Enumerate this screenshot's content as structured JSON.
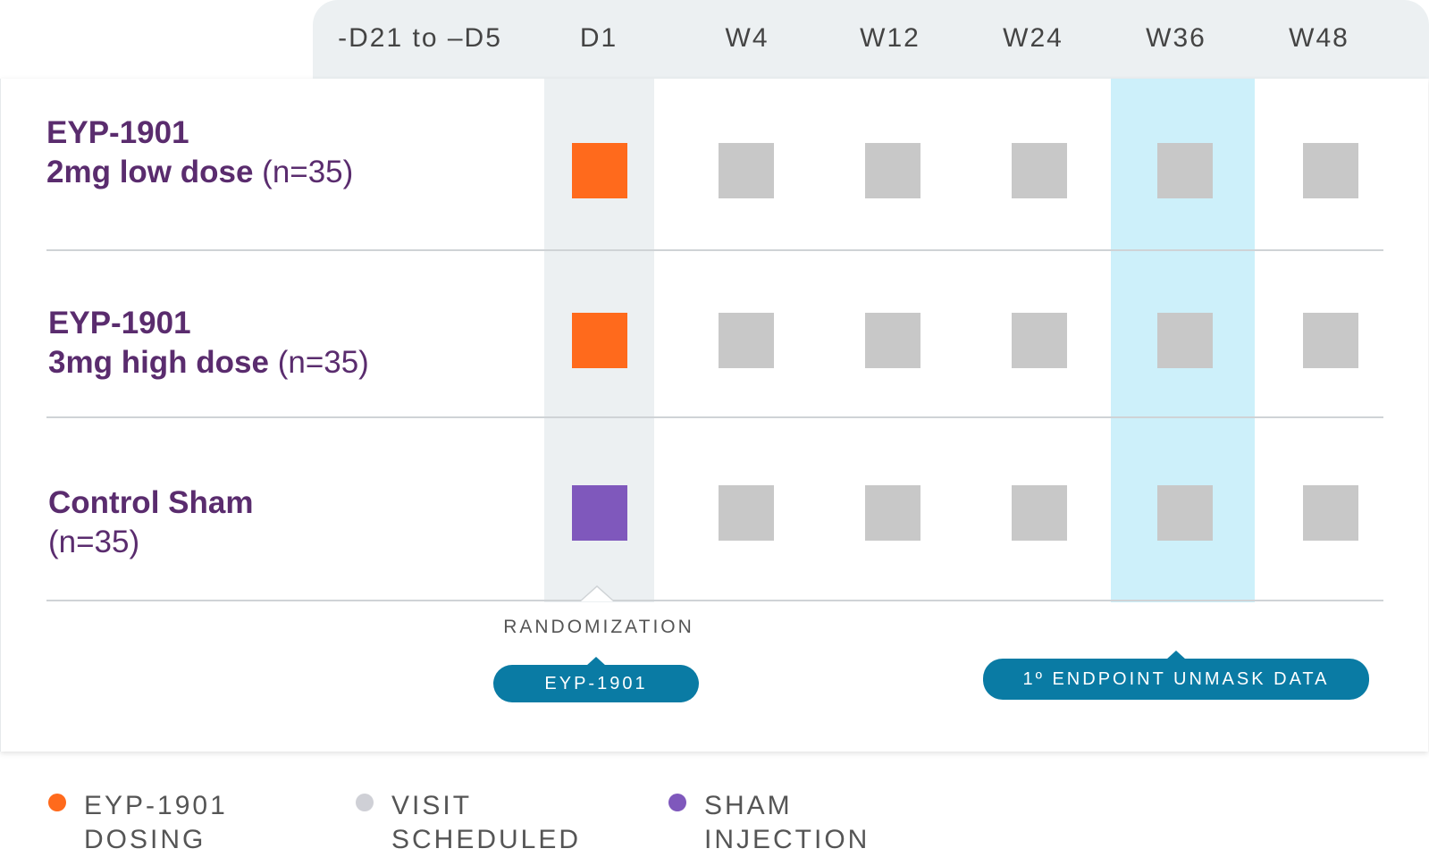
{
  "columns": [
    "-D21 to –D5",
    "D1",
    "W4",
    "W12",
    "W24",
    "W36",
    "W48"
  ],
  "rows": [
    {
      "name_line1": "EYP-1901",
      "name_line2_bold": "2mg low dose",
      "name_line2_rest": " (n=35)"
    },
    {
      "name_line1": "EYP-1901",
      "name_line2_bold": "3mg high dose",
      "name_line2_rest": " (n=35)"
    },
    {
      "name_line1": "Control Sham",
      "name_line2_bold": "",
      "name_line2_rest": "(n=35)"
    }
  ],
  "cells": [
    [
      "dosing",
      "visit",
      "visit",
      "visit",
      "visit",
      "visit"
    ],
    [
      "dosing",
      "visit",
      "visit",
      "visit",
      "visit",
      "visit"
    ],
    [
      "sham",
      "visit",
      "visit",
      "visit",
      "visit",
      "visit"
    ]
  ],
  "annotations": {
    "randomization": "RANDOMIZATION",
    "drug_pill": "EYP-1901",
    "endpoint_pill": "1º ENDPOINT UNMASK DATA"
  },
  "legend": [
    {
      "icon": "orange-dot",
      "color": "#ff6a1c",
      "line1": "EYP-1901",
      "line2": "DOSING"
    },
    {
      "icon": "grey-dot",
      "color": "#cfd0d6",
      "line1": "VISIT",
      "line2": "SCHEDULED"
    },
    {
      "icon": "purple-dot",
      "color": "#7f58bc",
      "line1": "SHAM",
      "line2": "INJECTION"
    }
  ],
  "colors": {
    "dosing": "#ff6a1c",
    "visit": "#c8c8c8",
    "sham": "#7f58bc",
    "label_text": "#5a2c6e",
    "pill": "#0a7ba4",
    "highlight_w36": "#cdf0fa",
    "highlight_d1": "#ecf0f2"
  }
}
